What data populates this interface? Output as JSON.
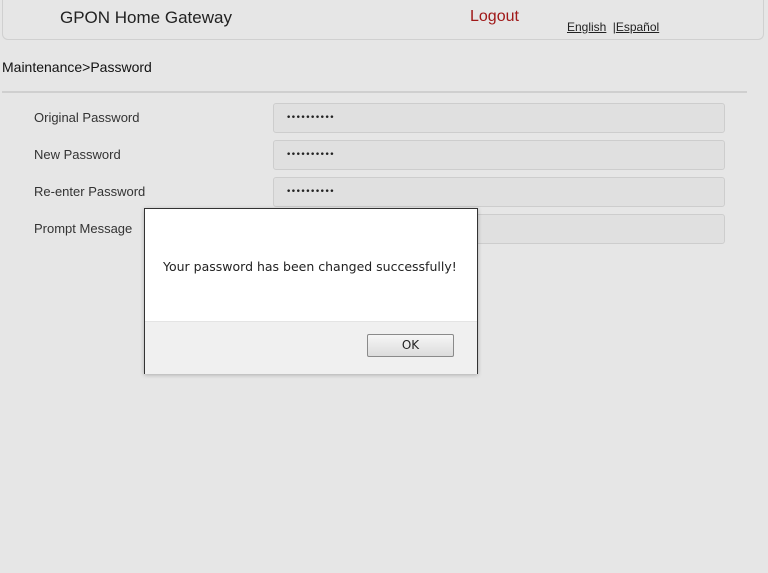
{
  "header": {
    "title": "GPON Home Gateway",
    "logout": "Logout",
    "lang_english": "English",
    "lang_separator": "|",
    "lang_spanish": "Español"
  },
  "breadcrumb": "Maintenance>Password",
  "form": {
    "original_password": {
      "label": "Original Password",
      "value": "••••••••••"
    },
    "new_password": {
      "label": "New Password",
      "value": "••••••••••"
    },
    "reenter_password": {
      "label": "Re-enter Password",
      "value": "••••••••••"
    },
    "prompt_message": {
      "label": "Prompt Message",
      "value": ""
    }
  },
  "dialog": {
    "message": "Your password has been changed successfully!",
    "ok_label": "OK"
  },
  "colors": {
    "background": "#e6e6e6",
    "logout": "#a01818"
  }
}
